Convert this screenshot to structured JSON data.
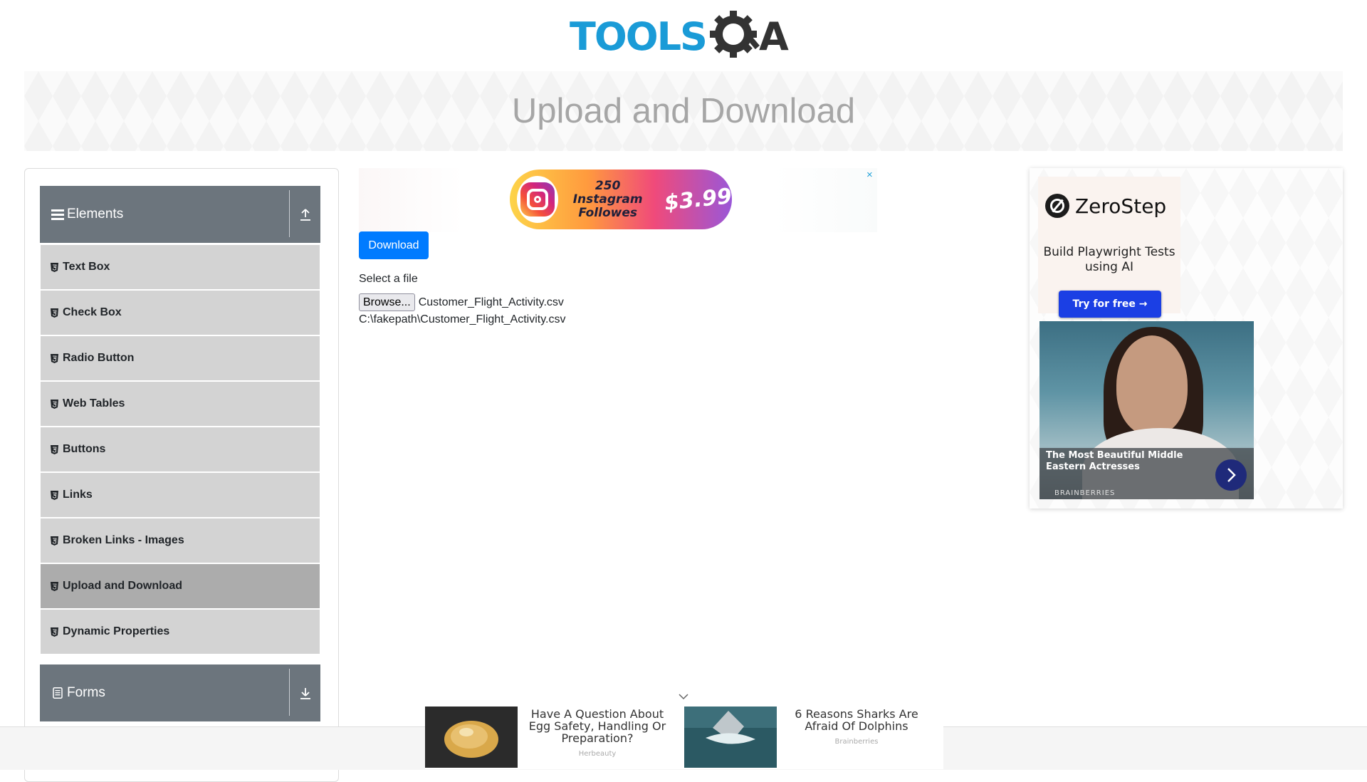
{
  "header": {
    "logo_text": "TOOLS",
    "logo_suffix": "A"
  },
  "banner": {
    "title": "Upload and Download"
  },
  "sidebar": {
    "groups": [
      {
        "label": "Elements",
        "state": "expanded"
      },
      {
        "label": "Forms",
        "state": "collapsed"
      }
    ],
    "items": [
      {
        "label": "Text Box"
      },
      {
        "label": "Check Box"
      },
      {
        "label": "Radio Button"
      },
      {
        "label": "Web Tables"
      },
      {
        "label": "Buttons"
      },
      {
        "label": "Links"
      },
      {
        "label": "Broken Links - Images"
      },
      {
        "label": "Upload and Download",
        "active": true
      },
      {
        "label": "Dynamic Properties"
      }
    ]
  },
  "ad_top": {
    "line1": "250 Instagram",
    "line2": "Followes",
    "price": "$3.99",
    "close": "×"
  },
  "main": {
    "download_label": "Download",
    "select_label": "Select a file",
    "browse_label": "Browse...",
    "file_name": "Customer_Flight_Activity.csv",
    "uploaded_path": "C:\\fakepath\\Customer_Flight_Activity.csv"
  },
  "right_ad": {
    "brand": "ZeroStep",
    "tagline": "Build Playwright Tests using AI",
    "cta": "Try for free →",
    "article_title": "The Most Beautiful Middle Eastern Actresses",
    "article_source": "BRAINBERRIES"
  },
  "bottom_ad": {
    "items": [
      {
        "title": "Have A Question About Egg Safety, Handling Or Preparation?",
        "source": "Herbeauty"
      },
      {
        "title": "6 Reasons Sharks Are Afraid Of Dolphins",
        "source": "Brainberries"
      }
    ]
  },
  "colors": {
    "brand_blue": "#1a9bd7",
    "primary_button": "#007bff",
    "sidebar_header": "#6c757d",
    "menu_item": "#d3d3d3",
    "menu_item_active": "#acacac"
  },
  "icons": {
    "logo": "tools-qa-gear-icon",
    "elements_group": "hamburger-icon",
    "forms_group": "document-icon",
    "menu_item": "html5-icon"
  }
}
